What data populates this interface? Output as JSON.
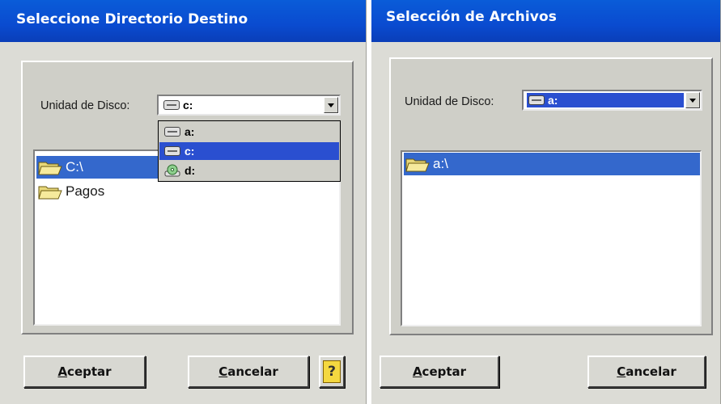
{
  "left_dialog": {
    "title": "Seleccione Directorio Destino",
    "drive_label": "Unidad de Disco:",
    "drive_value": "c:",
    "dropdown_options": [
      {
        "label": "a:",
        "icon": "floppy-drive-icon",
        "selected": false
      },
      {
        "label": "c:",
        "icon": "hard-drive-icon",
        "selected": true
      },
      {
        "label": "d:",
        "icon": "cd-drive-icon",
        "selected": false
      }
    ],
    "folders": [
      {
        "label": "C:\\",
        "icon": "open-folder-icon",
        "selected": true
      },
      {
        "label": "Pagos",
        "icon": "open-folder-icon",
        "selected": false
      }
    ],
    "accept_accel": "A",
    "accept_rest": "ceptar",
    "cancel_accel": "C",
    "cancel_rest": "ancelar",
    "help_label": "?"
  },
  "right_dialog": {
    "title": "Selección de Archivos",
    "drive_label": "Unidad de Disco:",
    "drive_value": "a:",
    "folders": [
      {
        "label": "a:\\",
        "icon": "open-folder-icon",
        "selected": true
      }
    ],
    "accept_accel": "A",
    "accept_rest": "ceptar",
    "cancel_accel": "C",
    "cancel_rest": "ancelar"
  },
  "colors": {
    "titlebar": "#0a4bd0",
    "selection": "#3468cc",
    "dialog_bg": "#dcdcd6"
  }
}
